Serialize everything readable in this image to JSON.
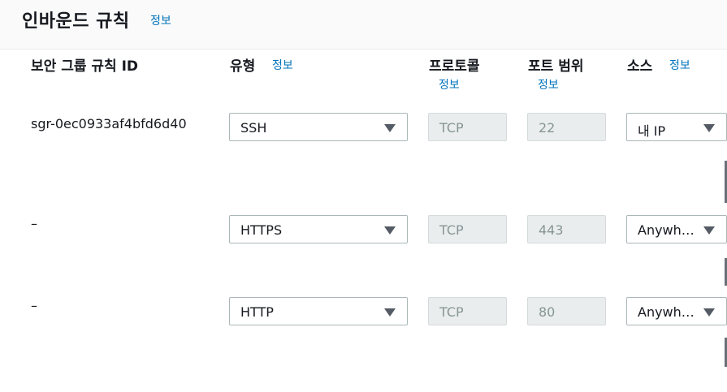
{
  "header": {
    "title": "인바운드 규칙",
    "info": "정보"
  },
  "columns": {
    "rule_id": "보안 그룹 규칙 ID",
    "type": "유형",
    "type_info": "정보",
    "protocol": "프로토콜",
    "protocol_info": "정보",
    "port_range": "포트 범위",
    "port_info": "정보",
    "source": "소스",
    "source_info": "정보"
  },
  "rules": [
    {
      "id": "sgr-0ec0933af4bfd6d40",
      "type": "SSH",
      "protocol": "TCP",
      "port": "22",
      "source": "내 IP"
    },
    {
      "id": "–",
      "type": "HTTPS",
      "protocol": "TCP",
      "port": "443",
      "source": "Anywh…"
    },
    {
      "id": "–",
      "type": "HTTP",
      "protocol": "TCP",
      "port": "80",
      "source": "Anywh…"
    }
  ]
}
